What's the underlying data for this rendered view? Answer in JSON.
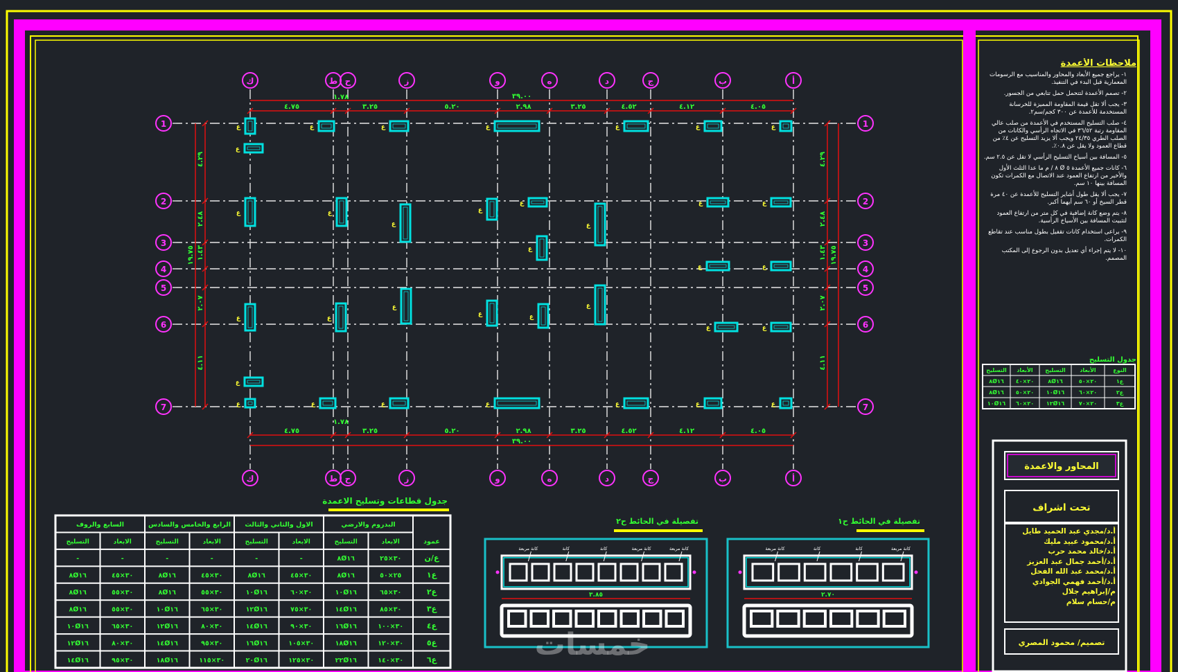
{
  "colors": {
    "background": "#1f2329",
    "frame_yellow": "#ffff00",
    "frame_magenta": "#ff00ff",
    "dim_red": "#e01010",
    "axis_white": "#e8e8e8",
    "column_cyan": "#00e0e0",
    "label_green": "#33ff33"
  },
  "axes": {
    "vertical": [
      "ك",
      "ط",
      "ح",
      "ز",
      "و",
      "ه",
      "د",
      "ج",
      "ب",
      "أ"
    ],
    "horizontal": [
      "1",
      "2",
      "3",
      "4",
      "5",
      "6",
      "7"
    ]
  },
  "dimensions": {
    "top_total": "٣٩.٠٠",
    "top_small": "١.٧٨",
    "bottom_small": "١.٧٨",
    "bottom_total": "٣٩.٠٠",
    "spans": [
      "٤.٧٥",
      "٣.٢٥",
      "٥.٢٠",
      "٢.٩٨",
      "٣.٢٥",
      "٤.٥٢",
      "٤.١٢",
      "٤.٠٥"
    ],
    "left_parts": [
      "٤.٢٩",
      "٢.٤٨",
      "١.٤٣",
      "٢.٠٧",
      "٤.١١"
    ],
    "left_total": "١٩.٧٥",
    "right_parts": [
      "٤.٢٩",
      "٢.٤٨",
      "١.٤٣",
      "٢.٠٧",
      "٤.١١"
    ],
    "right_total": "١٩.٧٥"
  },
  "column_tag": "ع",
  "notes": {
    "title": "ملاحظات الأعمدة",
    "items": [
      "١- يراجع جميع الأبعاد والمحاور والمناسيب مع الرسومات المعمارية قبل البدء في التنفيذ.",
      "٢- تصمم الأعمدة لتتحمل حمل تتابعي من الجسور.",
      "٣- يجب ألا تقل قيمة المقاومة المميزة للخرسانة المستخدمة للأعمدة عن ٣٠٠ كجم/سم٢.",
      "٤- صلب التسليح المستخدم في الأعمدة من صلب عالي المقاومة رتبة ٣٦/٥٢ في الاتجاه الرأسي والكانات من الصلب الطري ٢٤/٣٥ ويجب ألا يزيد التسليح عن ٤٪ من قطاع العمود ولا يقل عن ٠.٨٪.",
      "٥- المسافة بين أسياخ التسليح الرأسي لا تقل عن ٢.٥ سم.",
      "٦- كانات جميع الأعمدة ٥ Ø ٨ / م ما عدا الثلث الأول والأخير من ارتفاع العمود عند الاتصال مع الكمرات تكون المسافة بينها ١٠ سم.",
      "٧- يجب ألا يقل طول أشاير التسليح للأعمدة عن ٤٠ مرة قطر السيخ أو ٦٠ سم أيهما أكبر.",
      "٨- يتم وضع كانة إضافية في كل متر من ارتفاع العمود لتثبيت المسافة بين الأسياخ الرأسية.",
      "٩- يراعى استخدام كانات تقفيل بطول مناسب عند تقاطع الكمرات.",
      "١٠- لا يتم إجراء أي تعديل بدون الرجوع إلى المكتب المصمم."
    ]
  },
  "small_table": {
    "title": "جدول التسليح",
    "header": [
      "النوع",
      "الأبعاد",
      "التسليح",
      "الأبعاد",
      "التسليح"
    ],
    "rows": [
      [
        "ع١",
        "٢٠×٥٠",
        "٨Ø١٦",
        "٢٠×٤٠",
        "٨Ø١٦"
      ],
      [
        "ع٢",
        "٢٠×٦٠",
        "١٠Ø١٦",
        "٢٠×٥٠",
        "٨Ø١٦"
      ],
      [
        "ع٣",
        "٢٠×٧٠",
        "١٢Ø١٦",
        "٢٠×٦٠",
        "١٠Ø١٦"
      ]
    ]
  },
  "title_block": {
    "project_label": "المحاور والاعمدة",
    "supervision_label": "تحت اشراف",
    "names": [
      "أ.د/مجدي عبد الحميد طايل",
      "أ.د/محمود عبيد مليك",
      "أ.د/خالد محمد حرب",
      "أ.د/أحمد جمال عبد العزيز",
      "أ.د/محمد عبد الله الفحل",
      "أ.د/أحمد فهمي الجوادي",
      "م/إبراهيم جلال",
      "م/حسام سلام"
    ],
    "designer": "تصميم/ محمود المصري"
  },
  "schedule": {
    "title": "جدول قطاعات وتسليح الاعمدة",
    "groups": [
      "البدروم والارضي",
      "الاول والثاني والثالث",
      "الرابع والخامس والسادس",
      "السابع والروف"
    ],
    "col_type_label": "عمود",
    "sub_headers": [
      "الابعاد",
      "التسليح"
    ],
    "rows": [
      {
        "type": "ع/ن",
        "cells": [
          "٣٠×٢٥",
          "٨Ø١٦",
          "-",
          "-",
          "-",
          "-",
          "-",
          "-"
        ]
      },
      {
        "type": "ع١",
        "cells": [
          "٢٥×٥٠",
          "٨Ø١٦",
          "٣٠×٤٥",
          "٨Ø١٦",
          "٣٠×٤٥",
          "٨Ø١٦",
          "٣٠×٤٥",
          "٨Ø١٦"
        ]
      },
      {
        "type": "ع٢",
        "cells": [
          "٣٠×٦٥",
          "١٠Ø١٦",
          "٣٠×٦٠",
          "١٠Ø١٦",
          "٣٠×٥٥",
          "٨Ø١٦",
          "٣٠×٥٥",
          "٨Ø١٦"
        ]
      },
      {
        "type": "ع٣",
        "cells": [
          "٣٠×٨٥",
          "١٤Ø١٦",
          "٣٠×٧٥",
          "١٢Ø١٦",
          "٣٠×٦٥",
          "١٠Ø١٦",
          "٣٠×٥٥",
          "٨Ø١٦"
        ]
      },
      {
        "type": "ع٤",
        "cells": [
          "٣٠×١٠٠",
          "١٦Ø١٦",
          "٣٠×٩٠",
          "١٤Ø١٦",
          "٣٠×٨٠",
          "١٢Ø١٦",
          "٣٠×٦٥",
          "١٠Ø١٦"
        ]
      },
      {
        "type": "ع٥",
        "cells": [
          "٣٠×١٢٠",
          "١٨Ø١٦",
          "٣٠×١٠٥",
          "١٦Ø١٦",
          "٣٠×٩٥",
          "١٤Ø١٦",
          "٣٠×٨٠",
          "١٢Ø١٦"
        ]
      },
      {
        "type": "ع٦",
        "cells": [
          "٣٠×١٤٠",
          "٢٢Ø١٦",
          "٣٠×١٢٥",
          "٢٠Ø١٦",
          "٣٠×١١٥",
          "١٨Ø١٦",
          "٣٠×٩٥",
          "١٤Ø١٦"
        ]
      }
    ]
  },
  "details": [
    {
      "title": "تفصيلة في الحائط ح٢",
      "dim": "٣.٨٥",
      "tags": [
        "كانة مربعة",
        "كانة مربعة",
        "كانة",
        "كانة",
        "كانة مربعة"
      ]
    },
    {
      "title": "تفصيلة في الحائط ح١",
      "dim": "٢.٧٠",
      "tags": [
        "كانة مربعة",
        "كانة",
        "كانة",
        "كانة مربعة"
      ]
    }
  ],
  "watermark": "خمسات"
}
